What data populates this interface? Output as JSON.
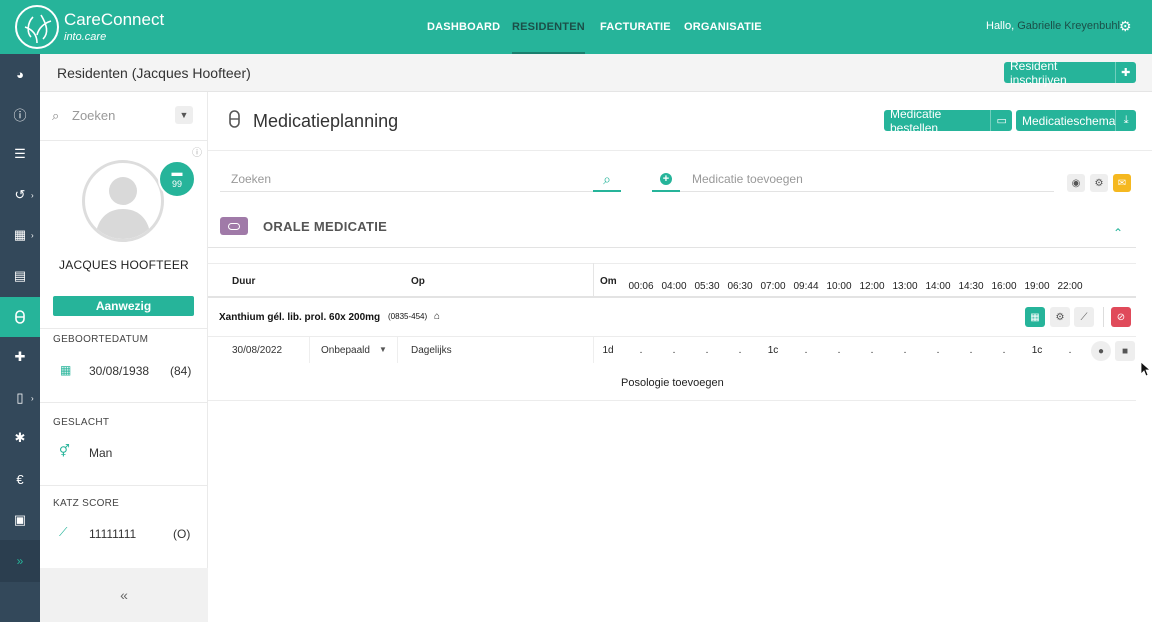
{
  "app": {
    "name": "CareConnect",
    "subtitle": "into.care"
  },
  "nav": [
    "DASHBOARD",
    "RESIDENTEN",
    "FACTURATIE",
    "ORGANISATIE"
  ],
  "greeting": {
    "prefix": "Hallo,",
    "user": "Gabrielle Kreyenbuhl"
  },
  "subheader": {
    "title": "Residenten (Jacques Hoofteer)",
    "button": "Resident inschrijven"
  },
  "resident": {
    "search_placeholder": "Zoeken",
    "badge": "99",
    "name": "JACQUES HOOFTEER",
    "status": "Aanwezig",
    "birth_label": "GEBOORTEDATUM",
    "birth_date": "30/08/1938",
    "age": "(84)",
    "gender_label": "GESLACHT",
    "gender": "Man",
    "katz_label": "KATZ SCORE",
    "katz": "11111111",
    "katz_cat": "(O)",
    "collapse": "«"
  },
  "main": {
    "title": "Medicatieplanning",
    "btn_order": "Medicatie bestellen",
    "btn_schema": "Medicatieschema",
    "search_placeholder": "Zoeken",
    "add_placeholder": "Medicatie toevoegen",
    "section": "ORALE MEDICATIE",
    "headers": {
      "duration": "Duur",
      "on": "Op",
      "om": "Om"
    },
    "times": [
      "00:06",
      "04:00",
      "05:30",
      "06:30",
      "07:00",
      "09:44",
      "10:00",
      "12:00",
      "13:00",
      "14:00",
      "14:30",
      "16:00",
      "19:00",
      "22:00"
    ],
    "medication": {
      "name": "Xanthium gél. lib. prol. 60x 200mg",
      "code": "(0835-454)"
    },
    "row": {
      "date": "30/08/2022",
      "duration": "Onbepaald",
      "frequency": "Dagelijks",
      "om": "1d",
      "values": [
        ".",
        ".",
        ".",
        ".",
        "1c",
        ".",
        ".",
        ".",
        ".",
        ".",
        ".",
        ".",
        "1c",
        "."
      ]
    },
    "add_posology": "Posologie toevoegen"
  },
  "colors": {
    "brand": "#26b49a",
    "sidebar": "#33485a",
    "danger": "#e04a5a",
    "warning": "#f5b820",
    "pill": "#a07aa8"
  }
}
